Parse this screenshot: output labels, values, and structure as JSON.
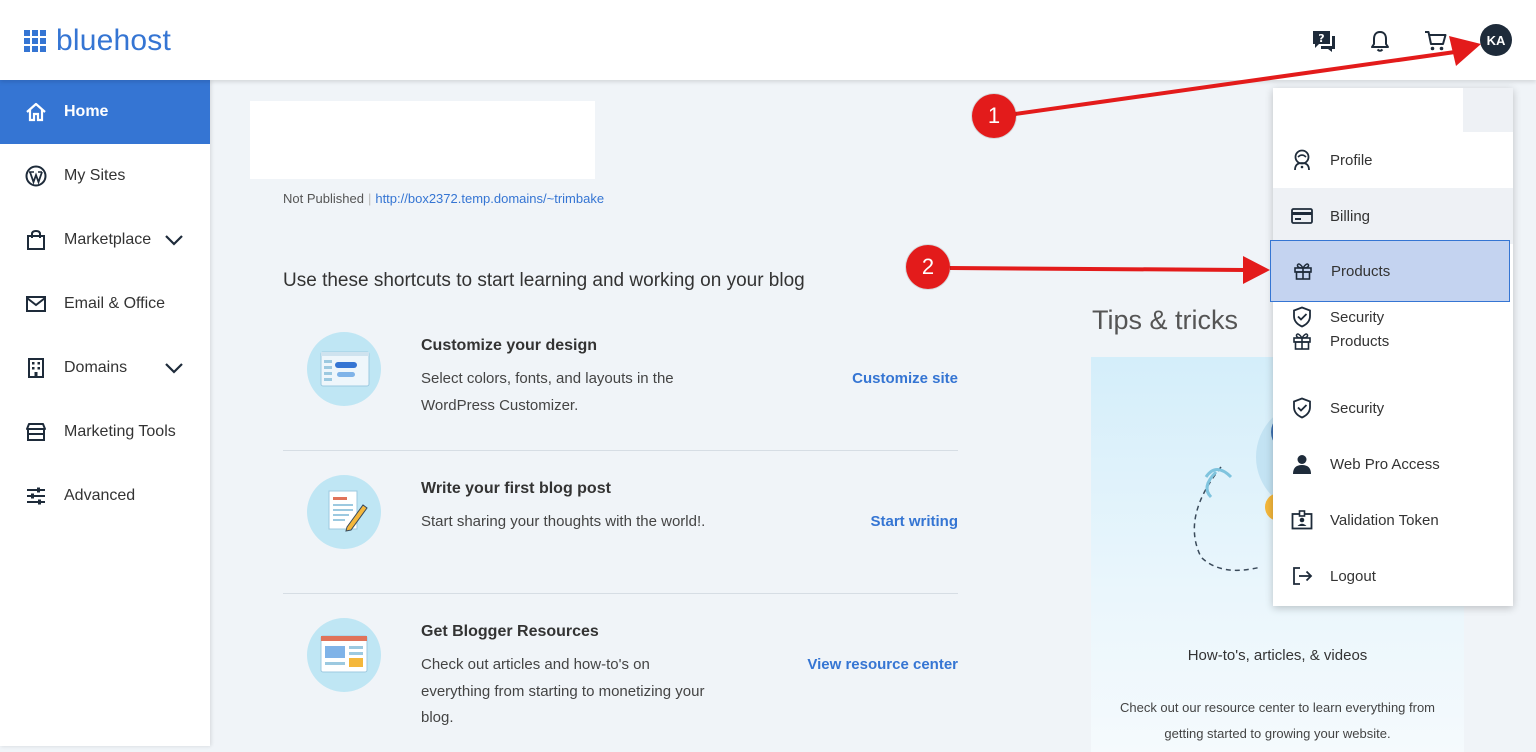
{
  "brand": {
    "name": "bluehost",
    "color": "#3575d3"
  },
  "header": {
    "icons": [
      "help-chat-icon",
      "bell-icon",
      "cart-icon"
    ],
    "avatar_initials": "KA"
  },
  "sidebar": {
    "items": [
      {
        "label": "Home",
        "icon": "home-icon",
        "active": true
      },
      {
        "label": "My Sites",
        "icon": "wordpress-icon"
      },
      {
        "label": "Marketplace",
        "icon": "shopping-bag-icon",
        "expandable": true
      },
      {
        "label": "Email & Office",
        "icon": "envelope-icon"
      },
      {
        "label": "Domains",
        "icon": "building-icon",
        "expandable": true
      },
      {
        "label": "Marketing Tools",
        "icon": "storefront-icon"
      },
      {
        "label": "Advanced",
        "icon": "sliders-icon"
      }
    ]
  },
  "site": {
    "status": "Not Published",
    "url": "http://box2372.temp.domains/~trimbake"
  },
  "shortcuts": {
    "title": "Use these shortcuts to start learning and working on your blog",
    "items": [
      {
        "title": "Customize your design",
        "description": "Select colors, fonts, and layouts in the WordPress Customizer.",
        "link": "Customize site"
      },
      {
        "title": "Write your first blog post",
        "description": "Start sharing your thoughts with the world!.",
        "link": "Start writing"
      },
      {
        "title": "Get Blogger Resources",
        "description": "Check out articles and how-to's on everything from starting to monetizing your blog.",
        "link": "View resource center"
      }
    ]
  },
  "tips": {
    "title": "Tips & tricks",
    "subtitle": "How-to's, articles, & videos",
    "description": "Check out our resource center to learn everything from getting started to growing your website."
  },
  "account_menu": {
    "items": [
      {
        "label": "Profile",
        "icon": "astronaut-icon"
      },
      {
        "label": "Billing",
        "icon": "credit-card-icon"
      },
      {
        "label": "Products",
        "icon": "gift-icon",
        "selected": true
      },
      {
        "label": "Security",
        "label2": "Products",
        "icon": "shield-check-icon",
        "icon2": "gift-icon"
      },
      {
        "label": "Security",
        "icon": "shield-check-icon"
      },
      {
        "label": "Web Pro Access",
        "icon": "person-icon"
      },
      {
        "label": "Validation Token",
        "icon": "id-badge-icon"
      },
      {
        "label": "Logout",
        "icon": "logout-icon"
      }
    ]
  },
  "annotations": {
    "badges": [
      "1",
      "2"
    ],
    "color": "#e31b1b"
  }
}
